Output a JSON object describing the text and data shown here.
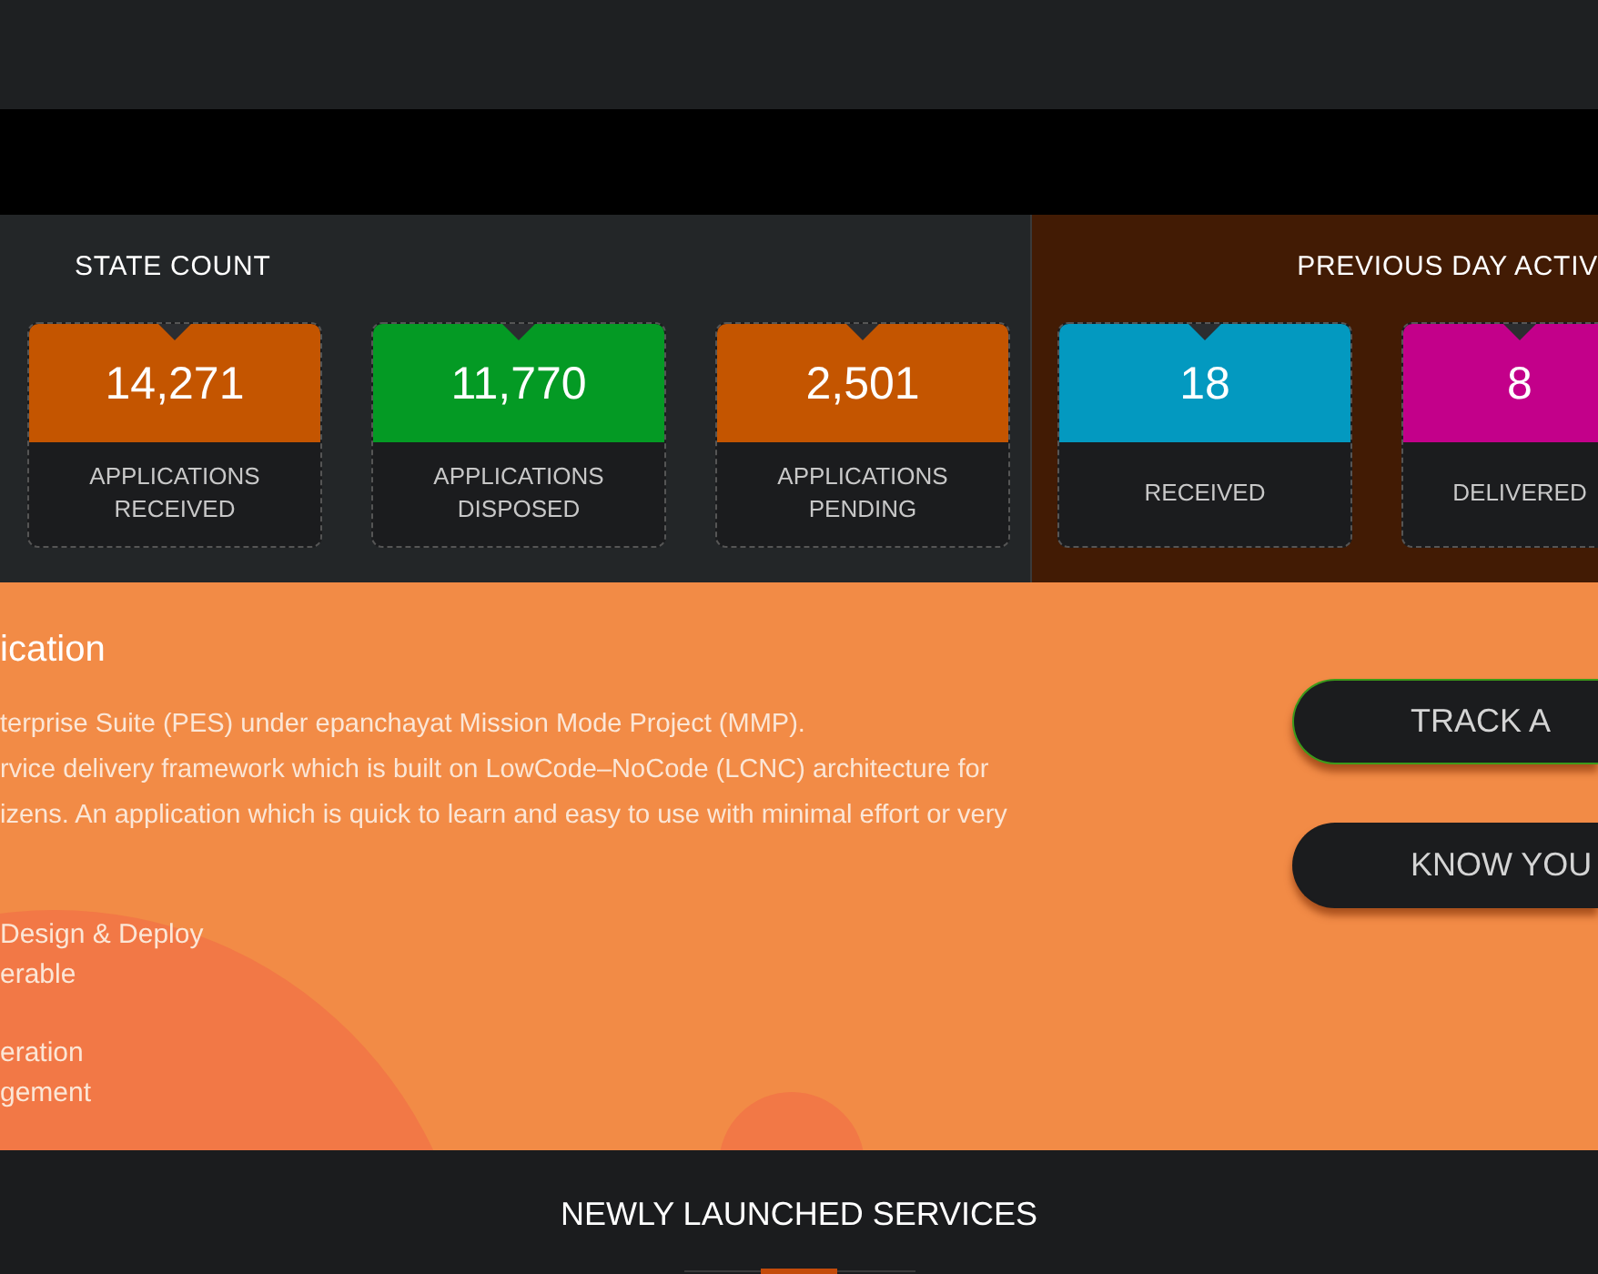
{
  "state_count": {
    "title": "STATE COUNT",
    "cards": [
      {
        "value": "14,271",
        "label": "APPLICATIONS RECEIVED",
        "color": "#c45500"
      },
      {
        "value": "11,770",
        "label": "APPLICATIONS DISPOSED",
        "color": "#049a24"
      },
      {
        "value": "2,501",
        "label": "APPLICATIONS PENDING",
        "color": "#c45500"
      }
    ]
  },
  "previous_day": {
    "title": "PREVIOUS DAY ACTIV",
    "cards": [
      {
        "value": "18",
        "label": "RECEIVED",
        "color": "#0399c0"
      },
      {
        "value": "8",
        "label": "DELIVERED",
        "color": "#c3008a"
      }
    ]
  },
  "about": {
    "heading": "ication",
    "paragraph_lines": [
      "terprise Suite (PES) under epanchayat Mission Mode Project (MMP).",
      "rvice delivery framework which is built on LowCode–NoCode (LCNC) architecture for",
      "izens. An application which is quick to learn and easy to use with minimal effort or very"
    ],
    "feature_groups": [
      [
        "Design & Deploy",
        "erable"
      ],
      [
        "eration",
        "gement"
      ]
    ],
    "buttons": [
      {
        "label": "TRACK A",
        "selected": true
      },
      {
        "label": "KNOW YOU",
        "selected": false
      }
    ]
  },
  "newly_launched": {
    "title": "NEWLY LAUNCHED SERVICES"
  }
}
